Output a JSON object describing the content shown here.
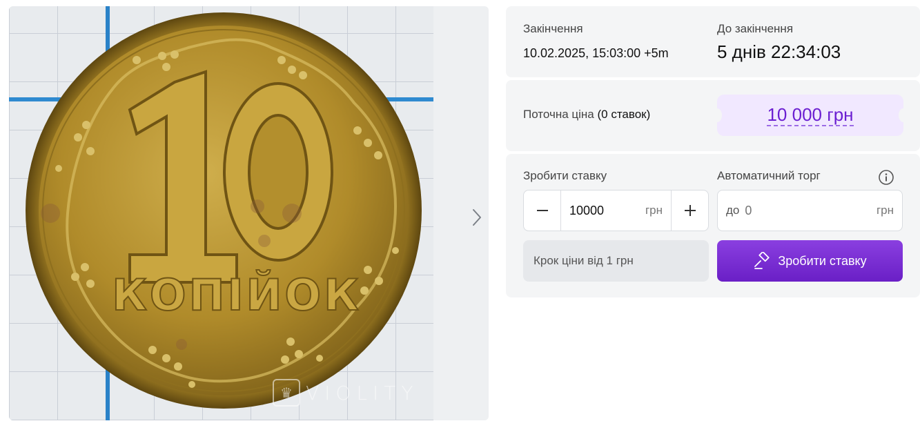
{
  "gallery": {
    "image_alt": "10 копійок",
    "coin": {
      "denomination": "10",
      "word": "копійок"
    },
    "watermark": "VIOLITY",
    "next_icon": "chevron-right-icon"
  },
  "auction": {
    "end_label": "Закінчення",
    "end_value": "10.02.2025, 15:03:00 +5m",
    "remaining_label": "До закінчення",
    "remaining_value": "5 днів 22:34:03"
  },
  "price": {
    "label": "Поточна ціна",
    "bids_count": "(0 ставок)",
    "value": "10 000 грн"
  },
  "bid": {
    "label": "Зробити ставку",
    "value": "10000",
    "unit": "грн",
    "minus_icon": "minus-icon",
    "plus_icon": "plus-icon",
    "auto_label": "Автоматичний торг",
    "auto_prefix": "до",
    "auto_placeholder": "0",
    "auto_unit": "грн",
    "info_icon": "info-icon",
    "step_text": "Крок ціни від 1 грн",
    "submit_label": "Зробити ставку",
    "submit_icon": "gavel-icon"
  },
  "colors": {
    "accent": "#7b2fd6",
    "price_bg": "#f1e8ff",
    "card_bg": "#f4f5f6",
    "coin_gold": "#b8942f"
  }
}
